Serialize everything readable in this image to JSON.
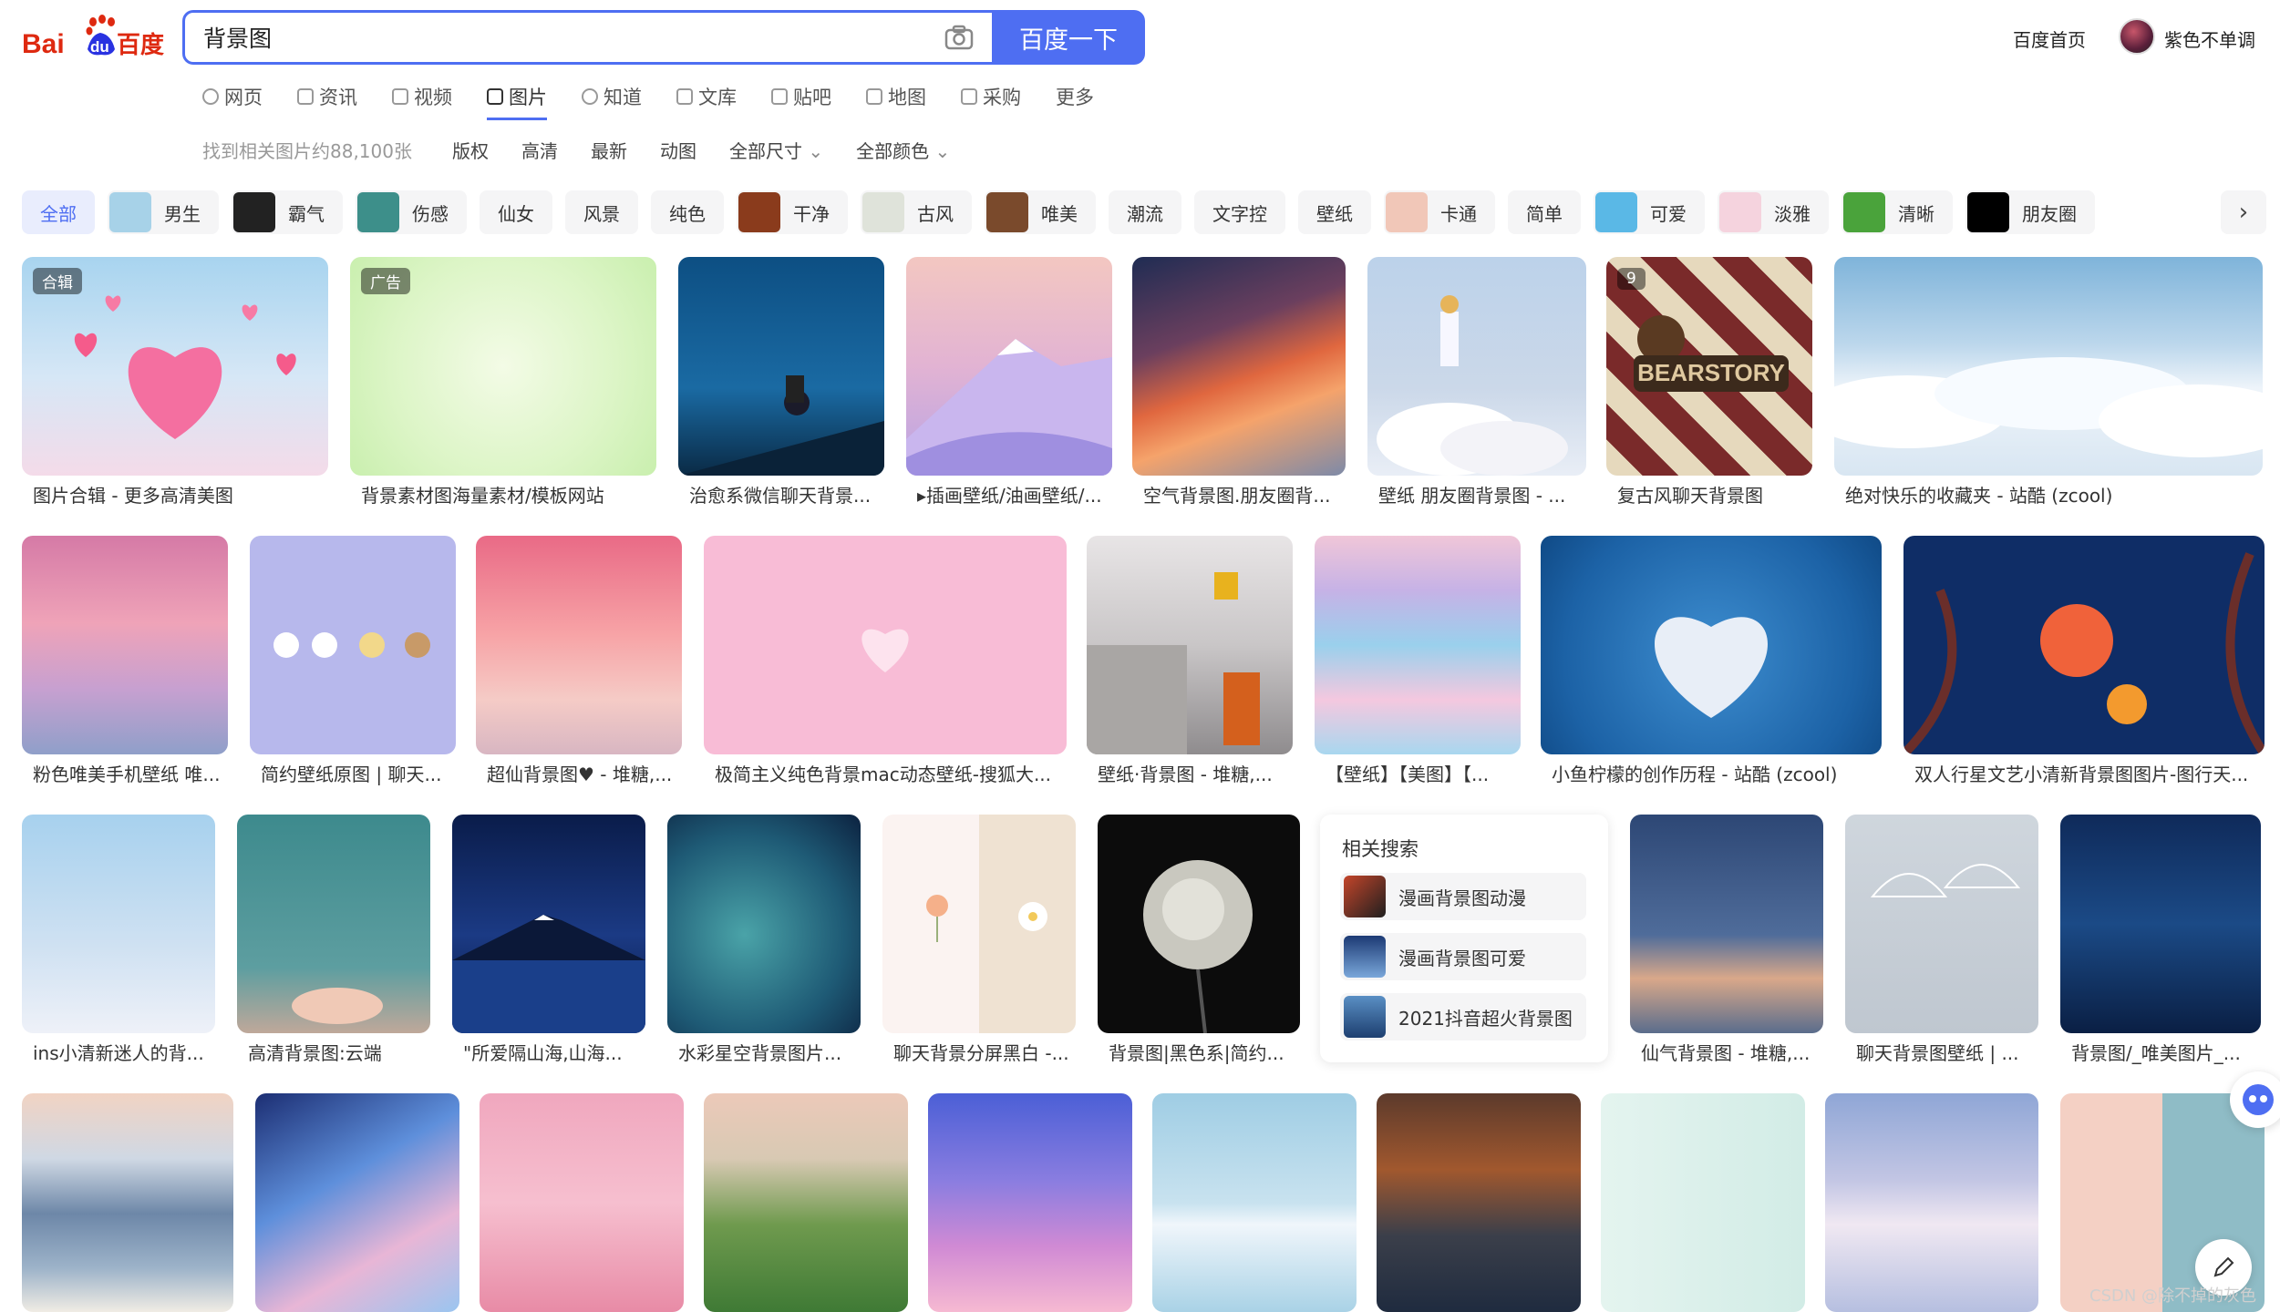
{
  "header": {
    "logo_text_1": "Bai",
    "logo_text_2": "du",
    "logo_text_3": "百度",
    "search_value": "背景图",
    "search_button": "百度一下",
    "home_link": "百度首页",
    "username": "紫色不单调"
  },
  "nav": {
    "items": [
      {
        "label": "网页",
        "icon": "search-icon"
      },
      {
        "label": "资讯",
        "icon": "news-icon"
      },
      {
        "label": "视频",
        "icon": "video-icon"
      },
      {
        "label": "图片",
        "icon": "image-icon"
      },
      {
        "label": "知道",
        "icon": "question-icon"
      },
      {
        "label": "文库",
        "icon": "doc-icon"
      },
      {
        "label": "贴吧",
        "icon": "tieba-icon"
      },
      {
        "label": "地图",
        "icon": "map-icon"
      },
      {
        "label": "采购",
        "icon": "shop-icon"
      },
      {
        "label": "更多",
        "icon": ""
      }
    ],
    "active": "图片"
  },
  "filters": {
    "count": "找到相关图片约88,100张",
    "items": [
      "版权",
      "高清",
      "最新",
      "动图"
    ],
    "size": "全部尺寸",
    "color": "全部颜色"
  },
  "chips": [
    {
      "label": "全部",
      "thumb": ""
    },
    {
      "label": "男生",
      "thumb": "#a7d2e8"
    },
    {
      "label": "霸气",
      "thumb": "#222222"
    },
    {
      "label": "伤感",
      "thumb": "#3d8f8a"
    },
    {
      "label": "仙女",
      "thumb": ""
    },
    {
      "label": "风景",
      "thumb": ""
    },
    {
      "label": "纯色",
      "thumb": ""
    },
    {
      "label": "干净",
      "thumb": "#8a3b1c"
    },
    {
      "label": "古风",
      "thumb": "#dfe3da"
    },
    {
      "label": "唯美",
      "thumb": "#7a4a2c"
    },
    {
      "label": "潮流",
      "thumb": ""
    },
    {
      "label": "文字控",
      "thumb": ""
    },
    {
      "label": "壁纸",
      "thumb": ""
    },
    {
      "label": "卡通",
      "thumb": "#f1c7b8"
    },
    {
      "label": "简单",
      "thumb": ""
    },
    {
      "label": "可爱",
      "thumb": "#5ab8e6"
    },
    {
      "label": "淡雅",
      "thumb": "#f5d3de"
    },
    {
      "label": "清晰",
      "thumb": "#4aa33b"
    },
    {
      "label": "朋友圈",
      "thumb": "#000000"
    }
  ],
  "images": {
    "row1": [
      {
        "caption": "图片合辑 - 更多高清美图",
        "badge": "合辑"
      },
      {
        "caption": "背景素材图海量素材/模板网站",
        "badge": "广告"
      },
      {
        "caption": "治愈系微信聊天背景...",
        "badge": ""
      },
      {
        "caption": "▸插画壁纸/油画壁纸/...",
        "badge": ""
      },
      {
        "caption": "空气背景图.朋友圈背...",
        "badge": ""
      },
      {
        "caption": "壁纸 朋友圈背景图 - ...",
        "badge": ""
      },
      {
        "caption": "复古风聊天背景图",
        "badge": "9"
      },
      {
        "caption": "绝对快乐的收藏夹 - 站酷 (zcool)",
        "badge": ""
      }
    ],
    "row2": [
      {
        "caption": "粉色唯美手机壁纸 唯..."
      },
      {
        "caption": "简约壁纸原图 | 聊天..."
      },
      {
        "caption": "超仙背景图♥ - 堆糖,..."
      },
      {
        "caption": "极简主义纯色背景mac动态壁纸-搜狐大..."
      },
      {
        "caption": "壁纸·背景图 - 堆糖,..."
      },
      {
        "caption": "【壁纸】【美图】【..."
      },
      {
        "caption": "小鱼柠檬的创作历程 - 站酷 (zcool)"
      },
      {
        "caption": "双人行星文艺小清新背景图图片-图行天..."
      }
    ],
    "row3": [
      {
        "caption": "ins小清新迷人的背..."
      },
      {
        "caption": "高清背景图:云端"
      },
      {
        "caption": "\"所爱隔山海,山海..."
      },
      {
        "caption": "水彩星空背景图片..."
      },
      {
        "caption": "聊天背景分屏黑白 -..."
      },
      {
        "caption": "背景图|黑色系|简约..."
      },
      {
        "caption": "仙气背景图 - 堆糖,..."
      },
      {
        "caption": "聊天背景图壁纸 | ..."
      },
      {
        "caption": "背景图/_唯美图片_..."
      }
    ]
  },
  "related": {
    "title": "相关搜索",
    "items": [
      "漫画背景图动漫",
      "漫画背景图可爱",
      "2021抖音超火背景图"
    ]
  },
  "bear_text": "BEARSTORY",
  "watermark": "CSDN @除不掉的灰色"
}
